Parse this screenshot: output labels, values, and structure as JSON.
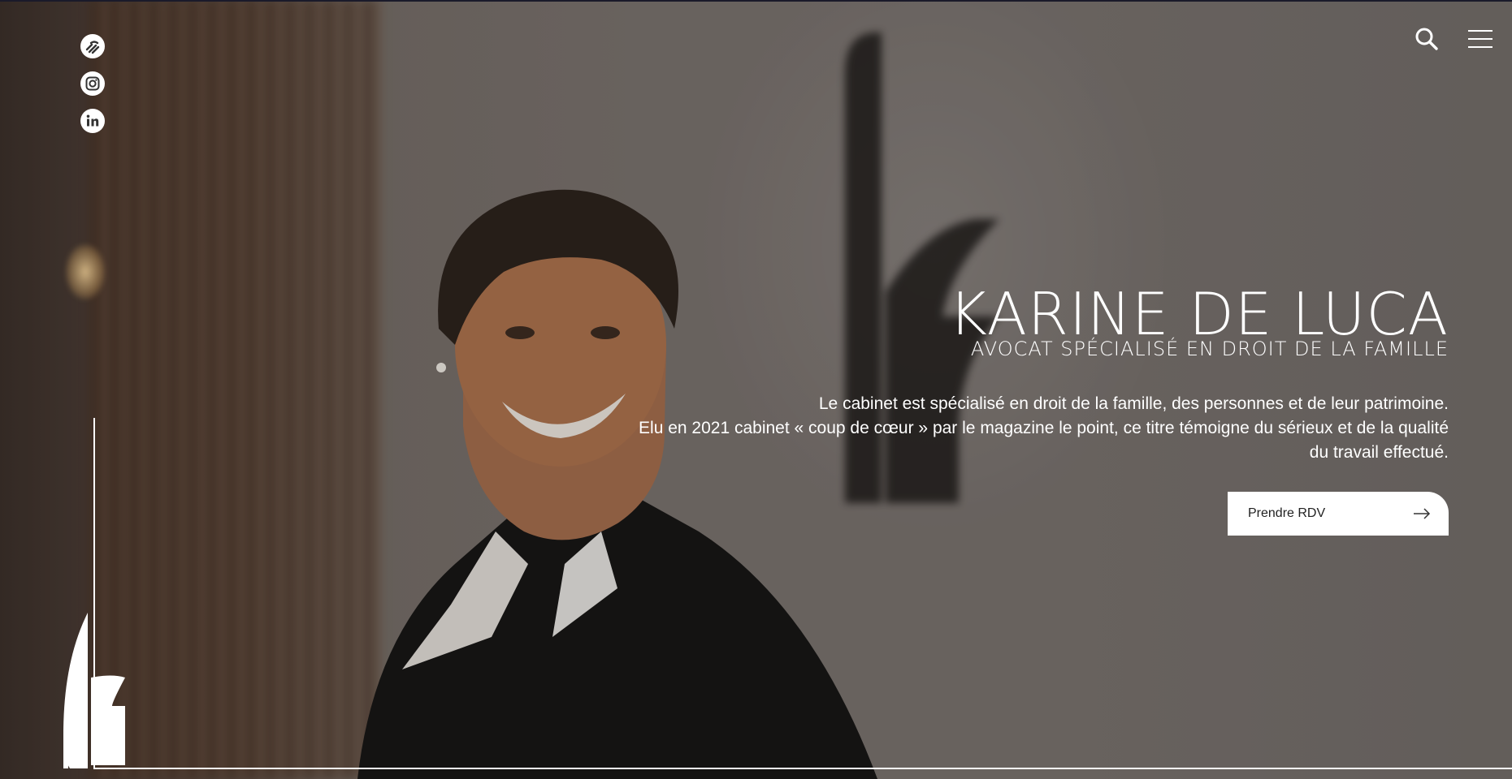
{
  "hero": {
    "title": "KARINE DE LUCA",
    "subtitle": "AVOCAT SPÉCIALISÉ EN DROIT DE LA FAMILLE",
    "description_line1": "Le cabinet est spécialisé en droit de la famille, des personnes et de leur patrimoine.",
    "description_line2": "Elu en 2021 cabinet « coup de cœur » par le magazine le point, ce titre témoigne du sérieux et de la qualité du travail effectué.",
    "cta_label": "Prendre RDV"
  },
  "icons": {
    "social": [
      "doctolib-icon",
      "instagram-icon",
      "linkedin-icon"
    ],
    "header": [
      "search-icon",
      "hamburger-menu-icon"
    ],
    "cta": "arrow-right-icon"
  },
  "colors": {
    "text": "#ffffff",
    "cta_background": "#ffffff",
    "cta_text": "#222222"
  }
}
